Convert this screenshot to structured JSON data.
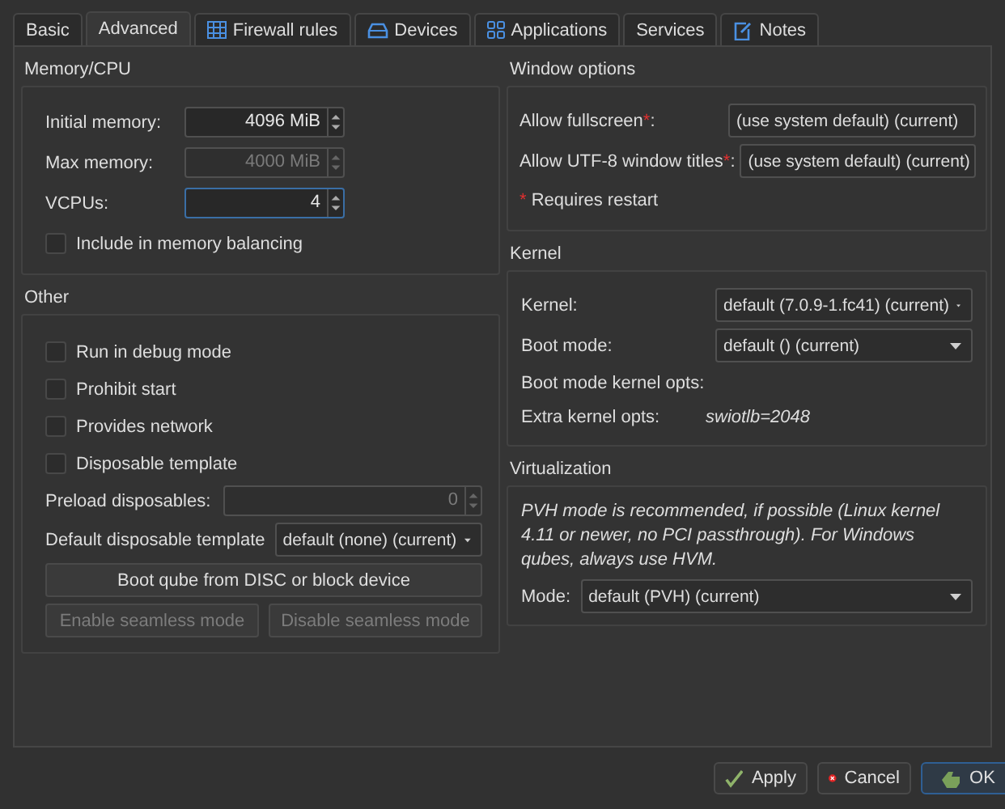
{
  "tabs": [
    {
      "label": "Basic",
      "selected": false
    },
    {
      "label": "Advanced",
      "selected": true
    },
    {
      "label": "Firewall rules",
      "selected": false
    },
    {
      "label": "Devices",
      "selected": false
    },
    {
      "label": "Applications",
      "selected": false
    },
    {
      "label": "Services",
      "selected": false
    },
    {
      "label": "Notes",
      "selected": false
    }
  ],
  "memory_cpu": {
    "title": "Memory/CPU",
    "fields": [
      {
        "label": "Initial memory:",
        "value": "4096 MiB",
        "disabled": false,
        "focused": false
      },
      {
        "label": "Max memory:",
        "value": "4000 MiB",
        "disabled": true,
        "focused": false
      },
      {
        "label": "VCPUs:",
        "value": "4",
        "disabled": false,
        "focused": true
      }
    ],
    "checkboxes": [
      {
        "label": "Include in memory balancing",
        "checked": false
      }
    ]
  },
  "other": {
    "title": "Other",
    "checkboxes": [
      {
        "label": "Run in debug mode",
        "checked": false
      },
      {
        "label": "Prohibit start",
        "checked": false
      },
      {
        "label": "Provides network",
        "checked": false
      },
      {
        "label": "Disposable template",
        "checked": false
      }
    ],
    "preload": {
      "label": "Preload disposables:",
      "value": "0",
      "disabled": true
    },
    "default_template": {
      "label": "Default disposable template",
      "value": "default (none) (current)"
    },
    "boot_button": {
      "label": "Boot qube from DISC or block device",
      "disabled": false
    },
    "seamless_buttons": [
      {
        "label": "Enable seamless mode",
        "disabled": true
      },
      {
        "label": "Disable seamless mode",
        "disabled": true
      }
    ]
  },
  "window_options": {
    "title": "Window options",
    "rows": [
      {
        "label": "Allow fullscreen",
        "mark": "*",
        "suffix": ":",
        "value": "(use system default) (current)"
      },
      {
        "label": "Allow UTF-8 window titles",
        "mark": "*",
        "suffix": ":",
        "value": "(use system default) (current)"
      }
    ],
    "note": {
      "mark": "*",
      "text": "Requires restart"
    }
  },
  "kernel": {
    "title": "Kernel",
    "rows": [
      {
        "kind": "select",
        "label": "Kernel:",
        "value": "default (7.0.9-1.fc41) (current)"
      },
      {
        "kind": "select",
        "label": "Boot mode:",
        "value": "default () (current)"
      },
      {
        "kind": "text",
        "label": "Boot mode kernel opts:"
      },
      {
        "kind": "text",
        "label": "Extra kernel opts:",
        "value": "swiotlb=2048"
      }
    ]
  },
  "virtualization": {
    "title": "Virtualization",
    "hint": "PVH mode is recommended, if possible (Linux kernel 4.11 or newer, no PCI passthrough). For Windows qubes, always use HVM.",
    "mode": {
      "label": "Mode:",
      "value": "default (PVH) (current)"
    }
  },
  "buttons": [
    {
      "label": "Apply",
      "default": false
    },
    {
      "label": "Cancel",
      "default": false
    },
    {
      "label": "OK",
      "default": true
    }
  ]
}
